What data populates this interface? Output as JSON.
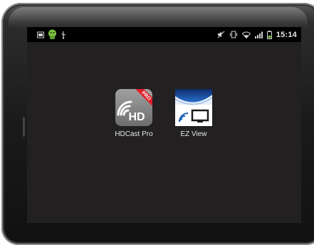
{
  "status_bar": {
    "time": "15:14",
    "left_icons": [
      "photo-notification-icon",
      "android-notification-icon",
      "usb-debug-icon"
    ],
    "right_icons": [
      "no-sound-icon",
      "vibrate-icon",
      "wifi-icon",
      "signal-icon",
      "battery-icon"
    ]
  },
  "home": {
    "apps": [
      {
        "label": "HDCast Pro",
        "icon": "hdcast-pro-app-icon",
        "badge": "PRO",
        "glyph": "HD"
      },
      {
        "label": "EZ View",
        "icon": "ez-view-app-icon"
      }
    ]
  },
  "colors": {
    "screen_bg": "#222021",
    "statusbar_bg": "#000000",
    "hdcast_icon_bg": "#8a8a8a",
    "pro_badge": "#e0202a",
    "ezview_blue": "#1a5fb4"
  }
}
